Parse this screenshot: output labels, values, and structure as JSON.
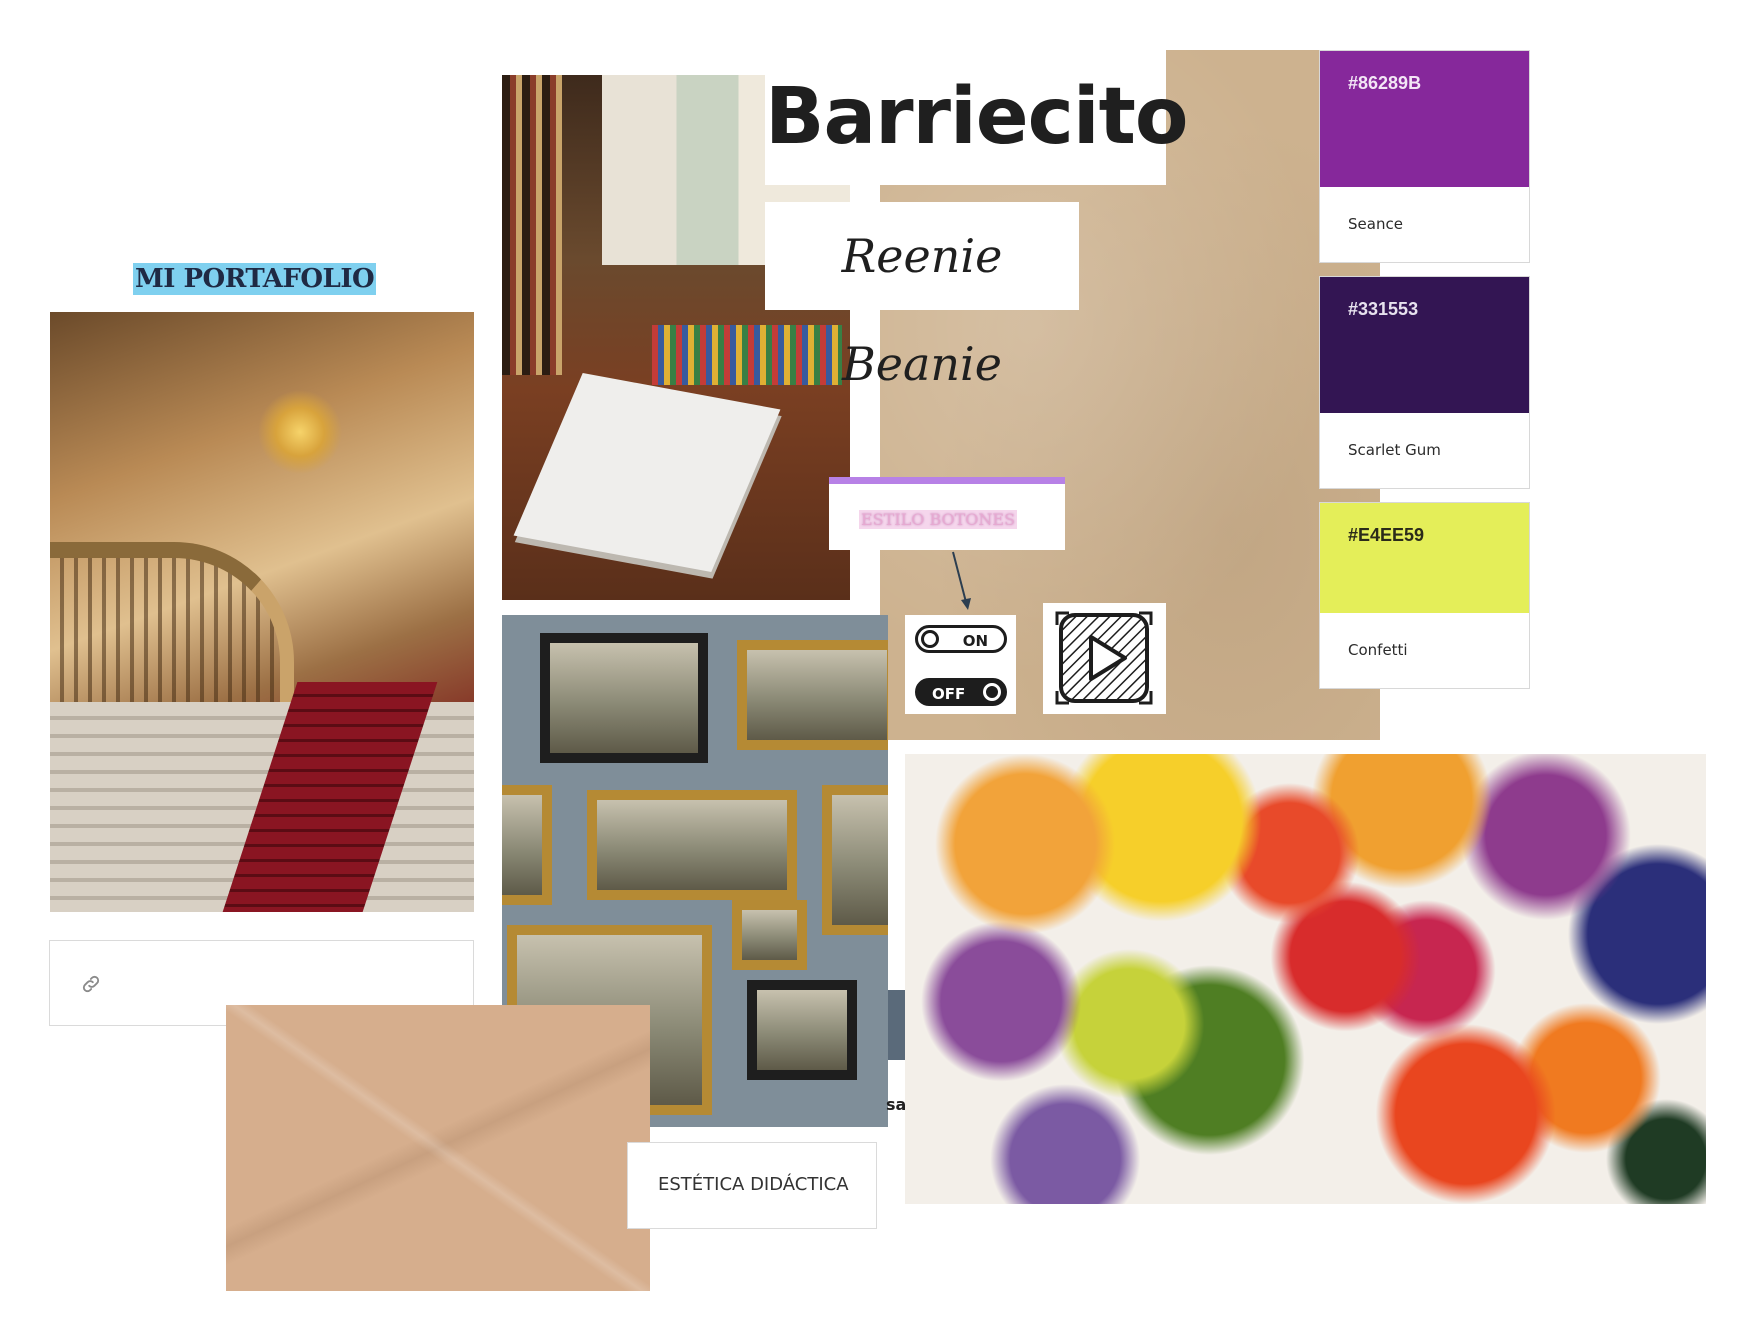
{
  "moodboard": {
    "title": "MI PORTAFOLIO",
    "fonts": {
      "display": "Barriecito",
      "handwritten": "Reenie Beanie"
    },
    "button_style_label": "ESTILO BOTONES",
    "toggle": {
      "on_label": "ON",
      "off_label": "OFF"
    },
    "caption": "ESTÉTICA DIDÁCTICA",
    "partial_text": "sa",
    "palette": [
      {
        "hex": "#86289B",
        "name": "Seance",
        "color": "#86289B",
        "text_color": "#f3e6f6"
      },
      {
        "hex": "#331553",
        "name": "Scarlet Gum",
        "color": "#331553",
        "text_color": "#e7e2ee"
      },
      {
        "hex": "#E4EE59",
        "name": "Confetti",
        "color": "#E4EE59",
        "text_color": "#2b2b1a"
      }
    ],
    "icons": {
      "link": "link-icon",
      "play": "play-icon",
      "arrow": "arrow-down-icon"
    },
    "images": {
      "staircase": "ornate-staircase-photo",
      "studio": "art-studio-desk-photo",
      "gallery": "framed-paintings-wall-photo",
      "paints": "oil-paint-palette-photo",
      "kraft_paper": "crumpled-kraft-paper-texture"
    }
  }
}
